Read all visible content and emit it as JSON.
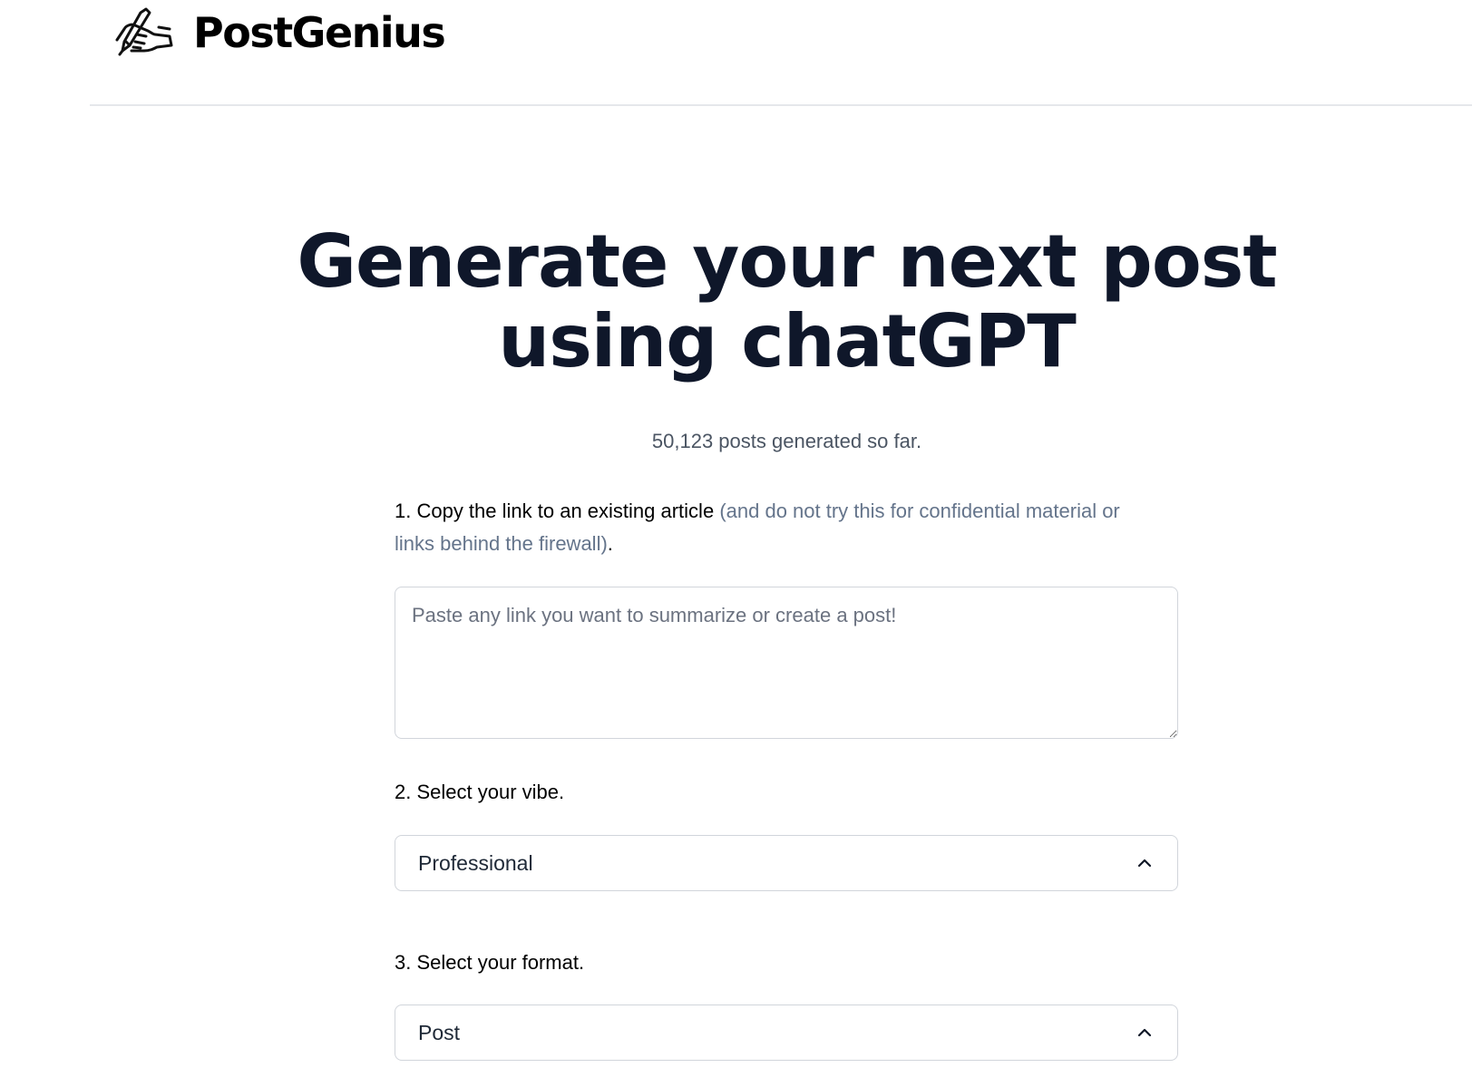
{
  "header": {
    "brand": "PostGenius",
    "logo_icon": "hand-writing-icon"
  },
  "hero": {
    "title_line1": "Generate your next post",
    "title_line2": "using chatGPT",
    "counter": "50,123 posts generated so far."
  },
  "form": {
    "step1": {
      "label": "1. Copy the link to an existing article",
      "note": "(and do not try this for confidential material or links behind the firewall)",
      "suffix": ".",
      "placeholder": "Paste any link you want to summarize or create a post!",
      "value": ""
    },
    "step2": {
      "label": "2. Select your vibe.",
      "selected": "Professional",
      "icon": "chevron-up-icon"
    },
    "step3": {
      "label": "3. Select your format.",
      "selected": "Post",
      "icon": "chevron-up-icon"
    }
  },
  "colors": {
    "heading": "#0f172a",
    "muted_text": "#64748b",
    "counter_text": "#4b5563",
    "border": "#d1d5db",
    "divider": "#e5e7eb"
  }
}
